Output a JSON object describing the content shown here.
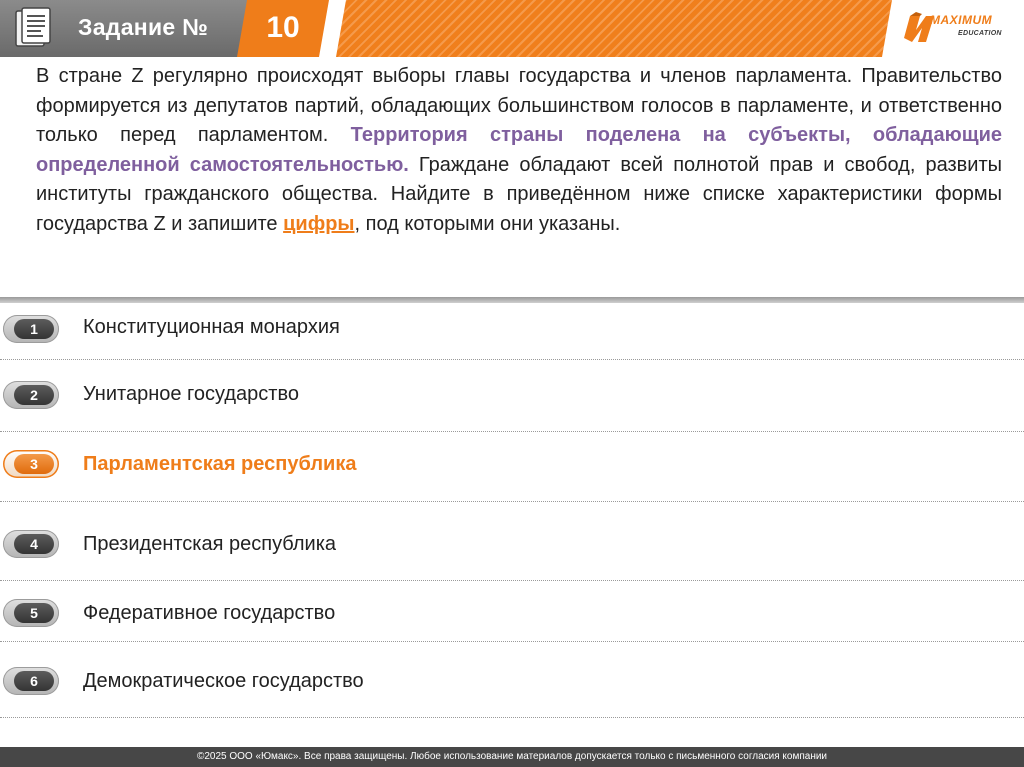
{
  "header": {
    "title": "Задание №",
    "number": "10",
    "logo_text": "MAXIMUM",
    "logo_subtext": "EDUCATION"
  },
  "task": {
    "text_before": "В стране Z регулярно происходят выборы главы государства и членов парламента. Правительство формируется из депутатов партий, обладающих большинством голосов в парламенте, и ответственно только перед парламентом. ",
    "highlight": "Территория страны поделена на субъекты, обладающие определенной самостоятельностью.",
    "text_middle": " Граждане обладают всей полнотой прав и свобод, развиты институты гражданского общества. Найдите в приведённом ниже списке характеристики формы государства Z и запишите ",
    "emphasis": "цифры",
    "text_after": ", под которыми они указаны."
  },
  "options": [
    {
      "number": "1",
      "label": "Конституционная монархия"
    },
    {
      "number": "2",
      "label": "Унитарное государство"
    },
    {
      "number": "3",
      "label": "Парламентская республика"
    },
    {
      "number": "4",
      "label": "Президентская республика"
    },
    {
      "number": "5",
      "label": "Федеративное государство"
    },
    {
      "number": "6",
      "label": "Демократическое государство"
    }
  ],
  "colors": {
    "accent": "#ef7d1a",
    "highlight": "#7f5f9e",
    "header_gray": "#7a7a7a",
    "footer": "#474747"
  },
  "footer": {
    "text": "©2025 ООО «Юмакс». Все права защищены. Любое использование материалов допускается только с  письменного согласия компании"
  }
}
